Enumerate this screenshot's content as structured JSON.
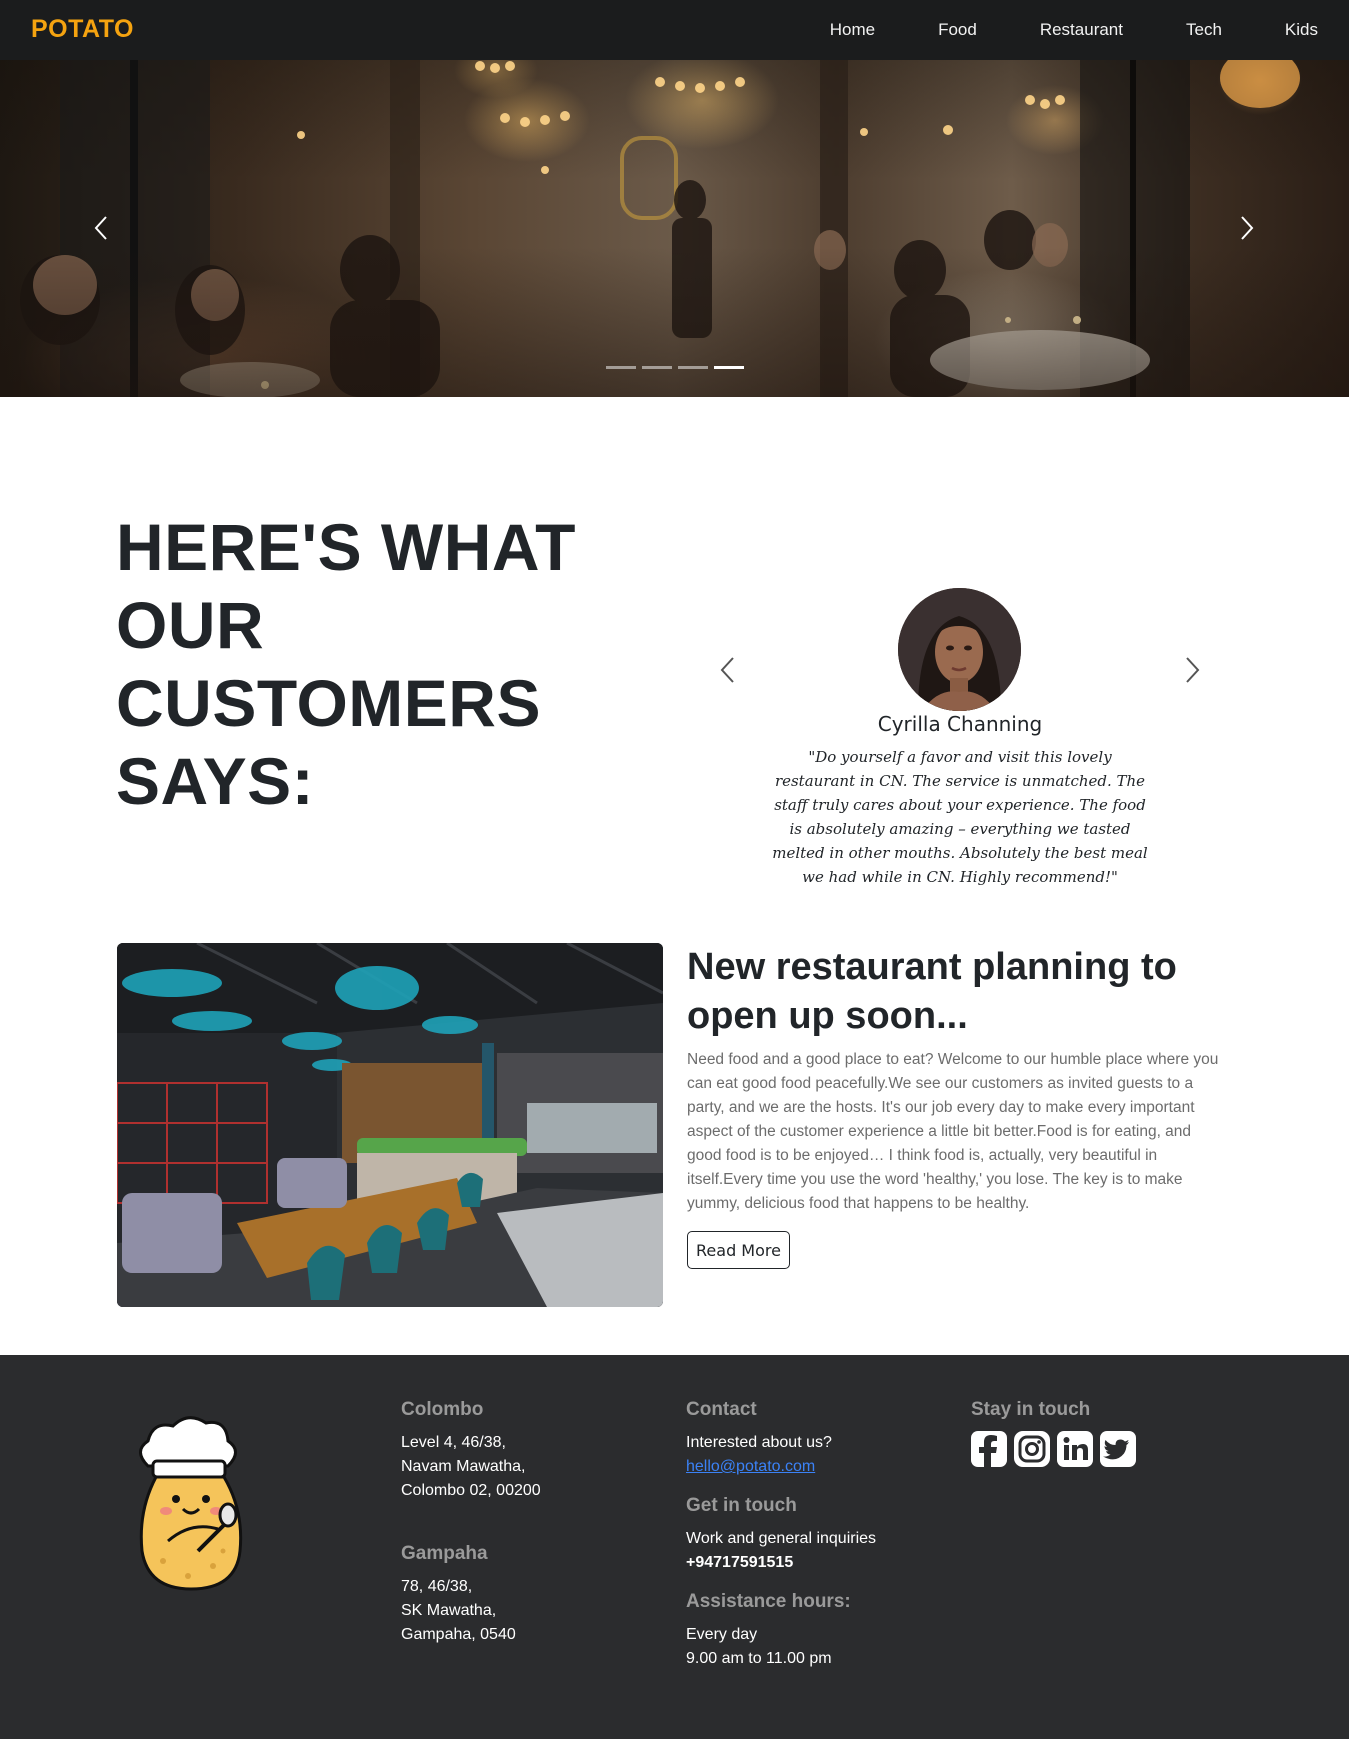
{
  "navbar": {
    "brand": "POTATO",
    "links": [
      "Home",
      "Food",
      "Restaurant",
      "Tech",
      "Kids"
    ]
  },
  "hero": {
    "slide_count": 4,
    "active_slide": 4,
    "prev_icon": "chevron-left-icon",
    "next_icon": "chevron-right-icon"
  },
  "testimonials": {
    "heading_lines": [
      "HERE'S WHAT",
      "OUR CUSTOMERS",
      "SAYS:"
    ],
    "name": "Cyrilla Channing",
    "quote": "\"Do yourself a favor and visit this lovely restaurant in CN. The service is unmatched. The staff truly cares about your experience. The food is absolutely amazing – everything we tasted melted in other mouths. Absolutely the best meal we had while in CN. Highly recommend!\""
  },
  "feature": {
    "title": "New restaurant planning to open up soon...",
    "text": "Need food and a good place to eat? Welcome to our humble place where you can eat good food peacefully.We see our customers as invited guests to a party, and we are the hosts. It's our job every day to make every important aspect of the customer experience a little bit better.Food is for eating, and good food is to be enjoyed… I think food is, actually, very beautiful in itself.Every time you use the word 'healthy,' you lose. The key is to make yummy, delicious food that happens to be healthy.",
    "button": "Read More"
  },
  "footer": {
    "colombo": {
      "heading": "Colombo",
      "lines": [
        "Level 4, 46/38,",
        "Navam Mawatha,",
        "Colombo 02, 00200"
      ]
    },
    "gampaha": {
      "heading": "Gampaha",
      "lines": [
        "78, 46/38,",
        "SK Mawatha,",
        "Gampaha, 0540"
      ]
    },
    "contact": {
      "heading": "Contact",
      "line": "Interested about us?",
      "email": "hello@potato.com"
    },
    "get_in_touch": {
      "heading": "Get in touch",
      "line": "Work and general inquiries",
      "phone": "+94717591515"
    },
    "assistance": {
      "heading": "Assistance hours:",
      "lines": [
        "Every day",
        "9.00 am to 11.00 pm"
      ]
    },
    "social": {
      "heading": "Stay in touch",
      "icons": [
        "facebook-icon",
        "instagram-icon",
        "linkedin-icon",
        "twitter-icon"
      ]
    }
  },
  "colors": {
    "brand": "#f5a310",
    "navbar_bg": "#1b1c1d",
    "footer_bg": "#2b2c2e",
    "link": "#3b82f6"
  }
}
